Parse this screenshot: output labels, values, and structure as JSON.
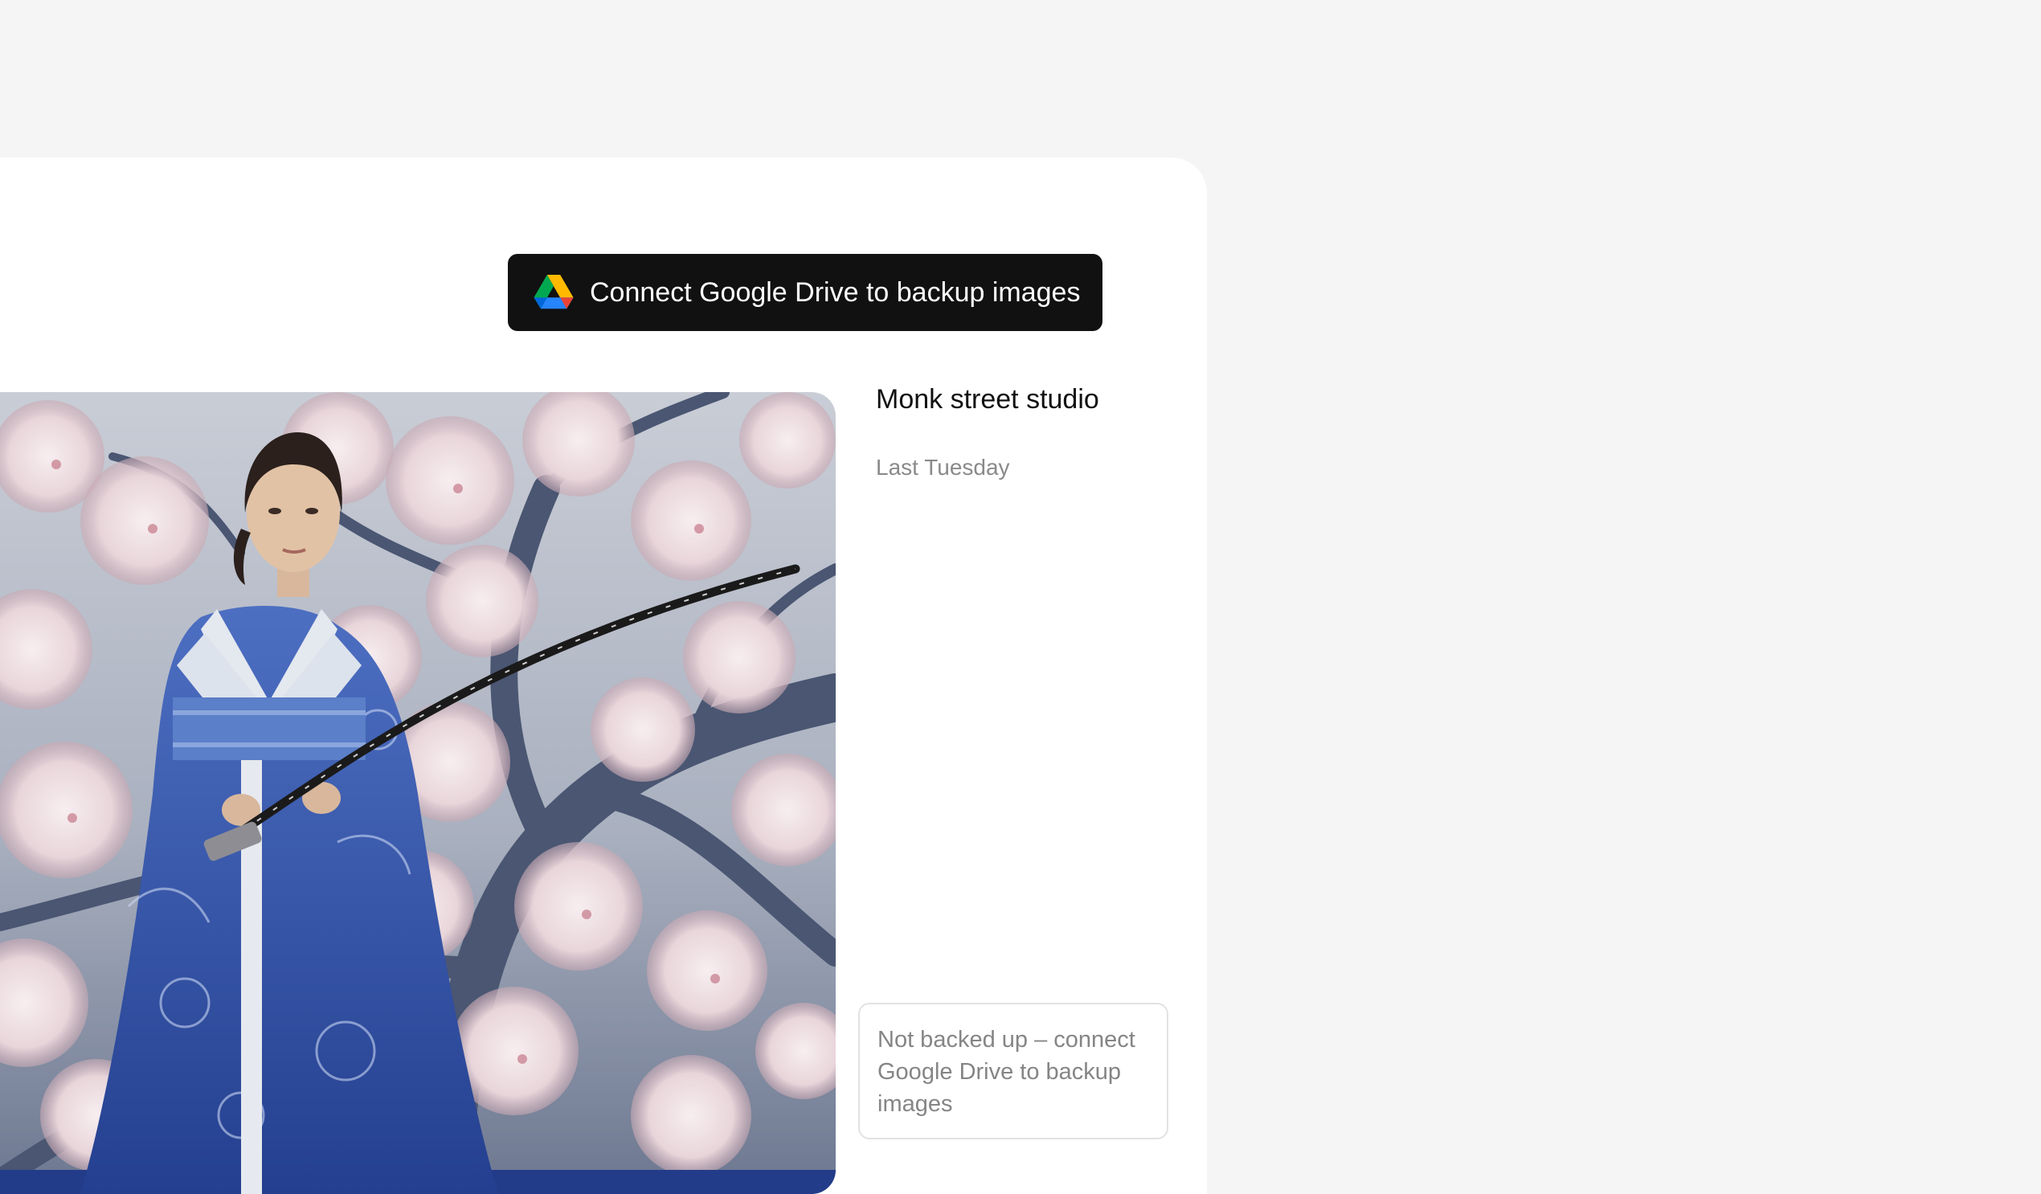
{
  "toolbar": {
    "connect_button_label": "Connect Google Drive to backup images",
    "connect_button_icon": "google-drive-icon"
  },
  "image": {
    "title": "Monk street studio",
    "date": "Last Tuesday",
    "backup_status": "Not backed up – connect Google Drive to backup images"
  },
  "colors": {
    "page_background": "#f5f5f5",
    "panel_background": "#ffffff",
    "button_background": "#111111",
    "button_text": "#ffffff",
    "title_text": "#111111",
    "muted_text": "#8a8a8a",
    "note_border": "#e2e2e2"
  }
}
